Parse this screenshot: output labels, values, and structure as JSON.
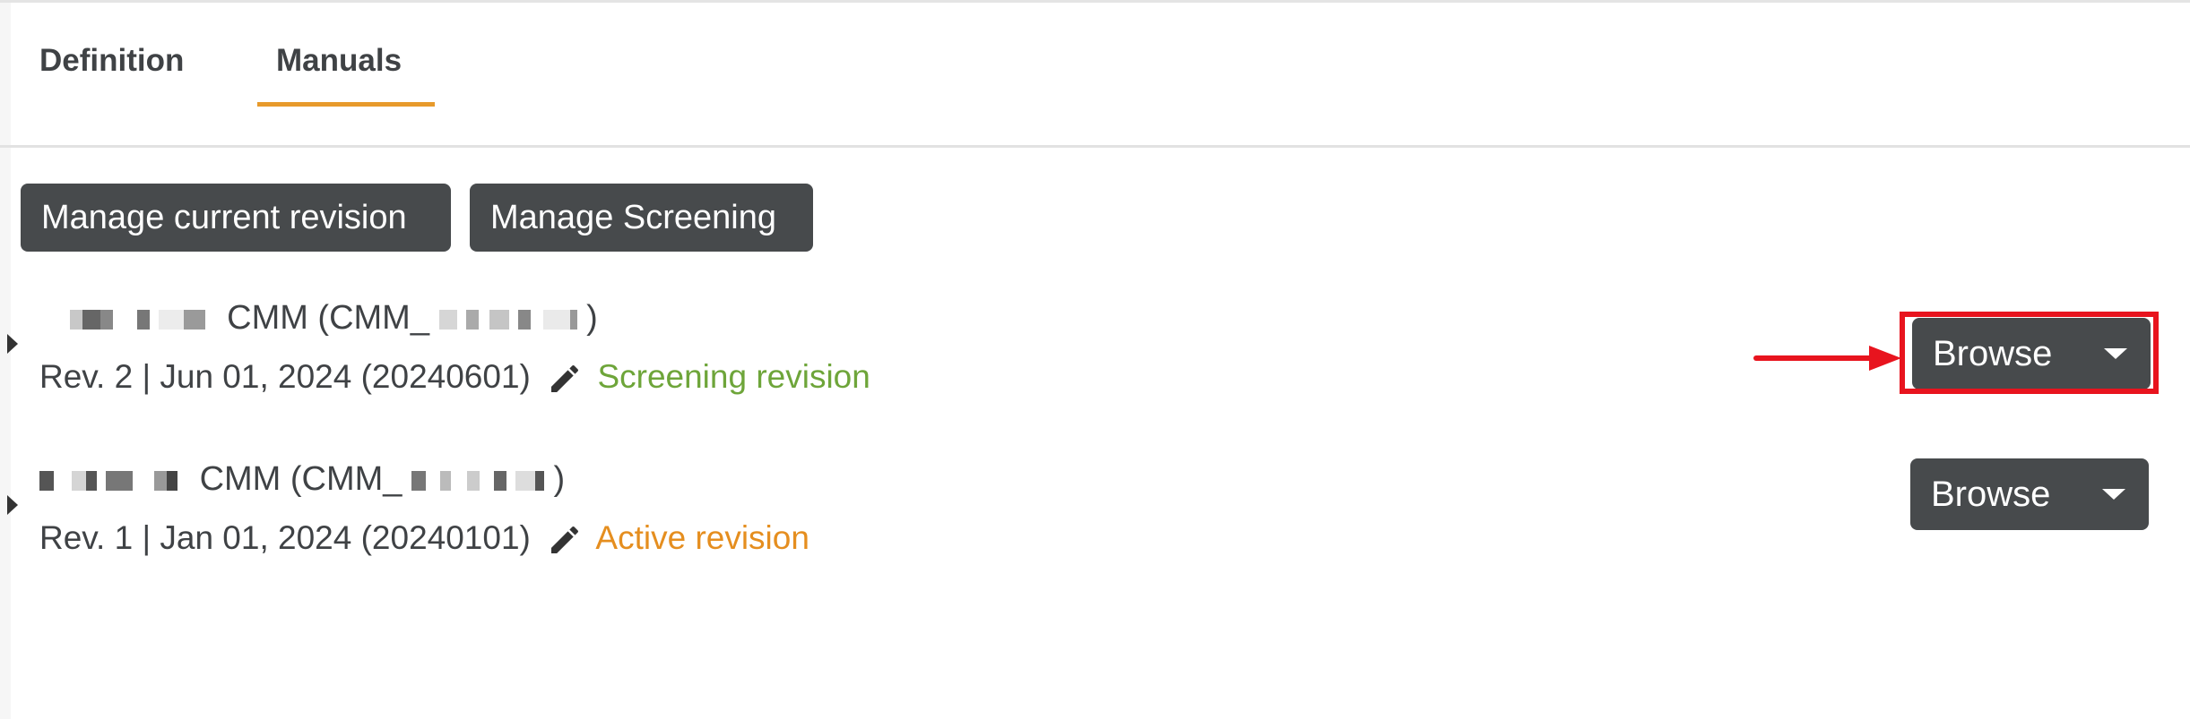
{
  "tabs": [
    {
      "label": "Definition",
      "active": false
    },
    {
      "label": "Manuals",
      "active": true
    }
  ],
  "actions": {
    "manage_current_revision": "Manage current revision",
    "manage_screening": "Manage Screening"
  },
  "manuals": [
    {
      "title_visible": "CMM (CMM_",
      "title_close": ")",
      "meta": "Rev. 2 | Jun 01, 2024 (20240601)",
      "status": "Screening revision",
      "status_color": "#6ea53a",
      "action_label": "Browse"
    },
    {
      "title_visible": "CMM (CMM_",
      "title_close": ")",
      "meta": "Rev. 1 | Jan 01, 2024 (20240101)",
      "status": "Active revision",
      "status_color": "#e58e1f",
      "action_label": "Browse"
    }
  ],
  "colors": {
    "accent": "#e79a2b",
    "button_dark": "#474a4c",
    "highlight": "#e8141e"
  }
}
